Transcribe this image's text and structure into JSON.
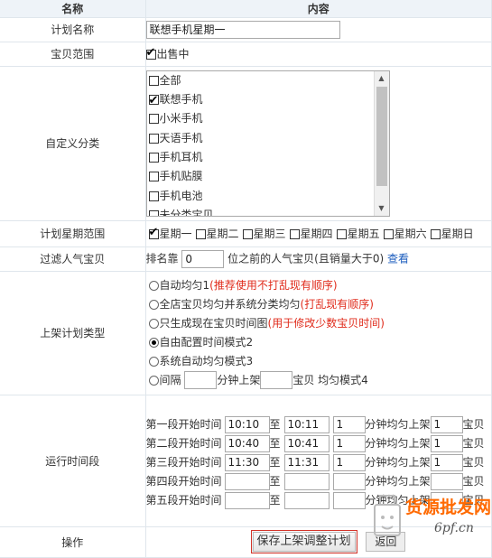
{
  "header": {
    "name_col": "名称",
    "content_col": "内容"
  },
  "plan_name": {
    "label": "计划名称",
    "value": "联想手机星期一"
  },
  "item_range": {
    "label": "宝贝范围",
    "option": "出售中",
    "checked": true
  },
  "category": {
    "label": "自定义分类",
    "items": [
      {
        "text": "全部",
        "checked": false
      },
      {
        "text": "联想手机",
        "checked": true
      },
      {
        "text": "小米手机",
        "checked": false
      },
      {
        "text": "天语手机",
        "checked": false
      },
      {
        "text": "手机耳机",
        "checked": false
      },
      {
        "text": "手机贴膜",
        "checked": false
      },
      {
        "text": "手机电池",
        "checked": false
      },
      {
        "text": "未分类宝贝",
        "checked": false
      }
    ]
  },
  "weekdays": {
    "label": "计划星期范围",
    "days": [
      {
        "text": "星期一",
        "checked": true
      },
      {
        "text": "星期二",
        "checked": false
      },
      {
        "text": "星期三",
        "checked": false
      },
      {
        "text": "星期四",
        "checked": false
      },
      {
        "text": "星期五",
        "checked": false
      },
      {
        "text": "星期六",
        "checked": false
      },
      {
        "text": "星期日",
        "checked": false
      }
    ]
  },
  "popular": {
    "label": "过滤人气宝贝",
    "prefix": "排名靠",
    "value": "0",
    "suffix": "位之前的人气宝贝(且销量大于0)",
    "link": "查看"
  },
  "plan_type": {
    "label": "上架计划类型",
    "options": [
      {
        "text": "自动均匀1",
        "note": "(推荐使用不打乱现有顺序)",
        "selected": false
      },
      {
        "text": "全店宝贝均匀并系统分类均匀",
        "note": "(打乱现有顺序)",
        "selected": false
      },
      {
        "text": "只生成现在宝贝时间图",
        "note": "(用于修改少数宝贝时间)",
        "selected": false
      },
      {
        "text": "自由配置时间模式2",
        "note": "",
        "selected": true
      },
      {
        "text": "系统自动均匀模式3",
        "note": "",
        "selected": false
      }
    ],
    "interval": {
      "prefix": "间隔",
      "mid": "分钟上架",
      "suffix": "宝贝 均匀模式4",
      "minutes": "",
      "count": ""
    }
  },
  "run_time": {
    "label": "运行时间段",
    "to_label": "至",
    "per_label": "分钟均匀上架",
    "tail": "宝贝",
    "segments": [
      {
        "label": "第一段开始时间",
        "start": "10:10",
        "end": "10:11",
        "minutes": "1",
        "count": "1"
      },
      {
        "label": "第二段开始时间",
        "start": "10:40",
        "end": "10:41",
        "minutes": "1",
        "count": "1"
      },
      {
        "label": "第三段开始时间",
        "start": "11:30",
        "end": "11:31",
        "minutes": "1",
        "count": "1"
      },
      {
        "label": "第四段开始时间",
        "start": "",
        "end": "",
        "minutes": "",
        "count": ""
      },
      {
        "label": "第五段开始时间",
        "start": "",
        "end": "",
        "minutes": "",
        "count": ""
      }
    ]
  },
  "actions": {
    "label": "操作",
    "save": "保存上架调整计划",
    "back": "返回"
  },
  "watermark": {
    "line1": "货源批发网",
    "line2": "6pf.cn"
  }
}
